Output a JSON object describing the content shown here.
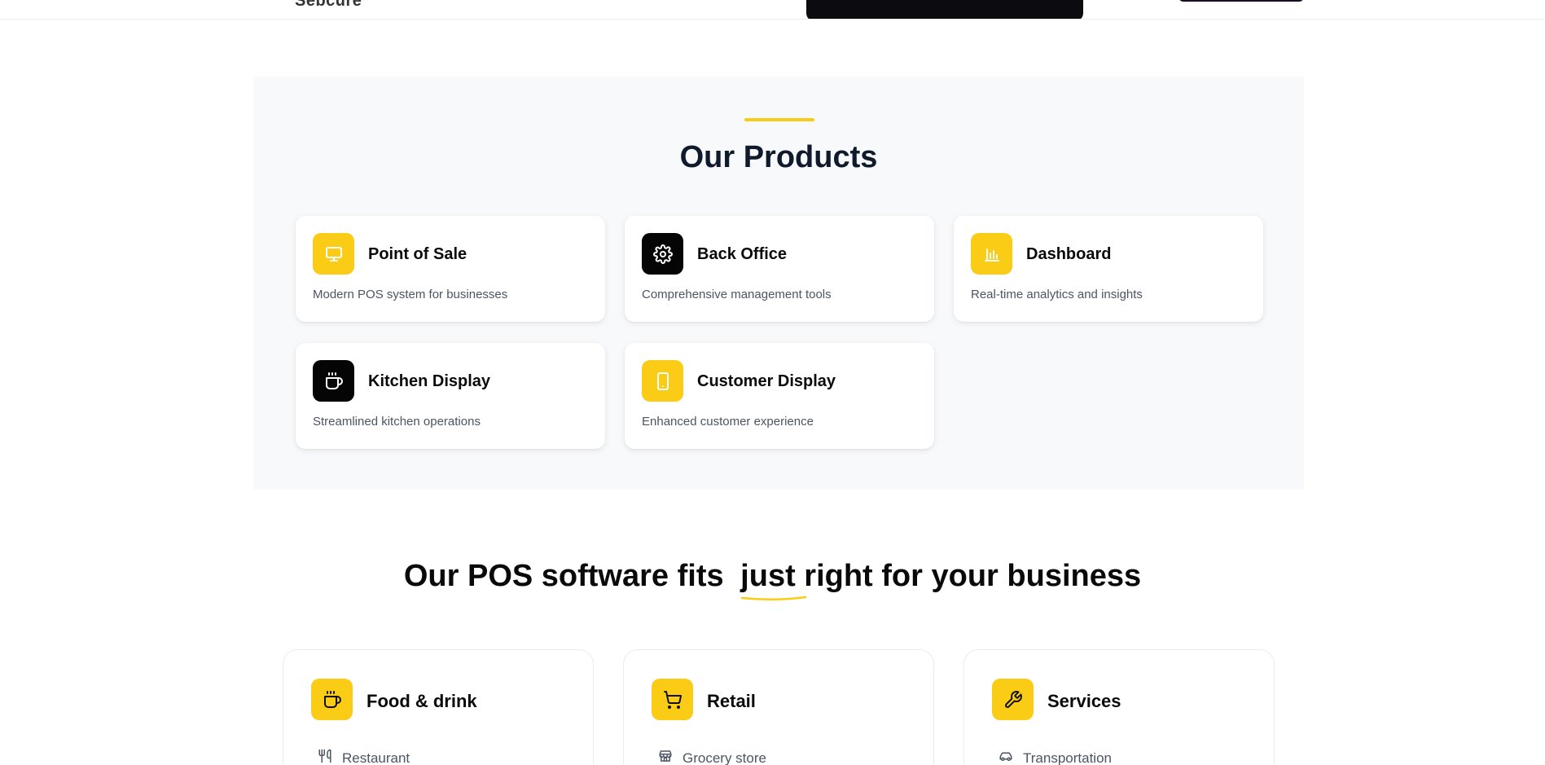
{
  "header": {
    "logo_fragment": "Sebcure"
  },
  "products": {
    "title": "Our Products",
    "items": [
      {
        "title": "Point of Sale",
        "desc": "Modern POS system for businesses",
        "icon": "monitor-icon",
        "icon_bg": "#facc15"
      },
      {
        "title": "Back Office",
        "desc": "Comprehensive management tools",
        "icon": "gear-icon",
        "icon_bg": "#050505"
      },
      {
        "title": "Dashboard",
        "desc": "Real-time analytics and insights",
        "icon": "bar-chart-icon",
        "icon_bg": "#facc15"
      },
      {
        "title": "Kitchen Display",
        "desc": "Streamlined kitchen operations",
        "icon": "coffee-cup-icon",
        "icon_bg": "#050505"
      },
      {
        "title": "Customer Display",
        "desc": "Enhanced customer experience",
        "icon": "tablet-icon",
        "icon_bg": "#facc15"
      }
    ]
  },
  "fit": {
    "title_start": "Our POS software fits",
    "title_highlight": "just right",
    "title_end": "for your business"
  },
  "business_types": [
    {
      "title": "Food & drink",
      "icon": "coffee-cup-icon",
      "first_item": "Restaurant",
      "first_item_icon": "utensils-icon"
    },
    {
      "title": "Retail",
      "icon": "shopping-cart-icon",
      "first_item": "Grocery store",
      "first_item_icon": "store-icon"
    },
    {
      "title": "Services",
      "icon": "wrench-icon",
      "first_item": "Transportation",
      "first_item_icon": "car-icon"
    }
  ],
  "colors": {
    "accent": "#facc15",
    "dark": "#050505",
    "section_bg": "#f8f9fa",
    "muted_text": "#4b5563"
  }
}
